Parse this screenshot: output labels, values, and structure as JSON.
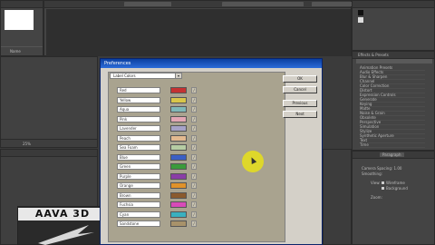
{
  "colors": {
    "workspace_bg": "#3b3b3b",
    "panel_bg": "#444444",
    "dialog_bg": "#d4d0c8",
    "dialog_title": "#0b3fa0",
    "cursor_highlight": "#e8e01a"
  },
  "project_panel": {
    "name_column": "Name"
  },
  "timeline_panel": {
    "zoom_label": "25%"
  },
  "logo": {
    "text": "AAVA 3D"
  },
  "dialog": {
    "title": "Preferences",
    "category": "Label Colors",
    "labels": [
      {
        "name": "Red",
        "color": "#c43232"
      },
      {
        "name": "Yellow",
        "color": "#d8c64a"
      },
      {
        "name": "Aqua",
        "color": "#7fb8b8"
      },
      {
        "name": "Pink",
        "color": "#e3a6b4"
      },
      {
        "name": "Lavender",
        "color": "#a6a2c7"
      },
      {
        "name": "Peach",
        "color": "#e2b98f"
      },
      {
        "name": "Sea Foam",
        "color": "#b6cca3"
      },
      {
        "name": "Blue",
        "color": "#3b5fc4"
      },
      {
        "name": "Green",
        "color": "#3b9a3b"
      },
      {
        "name": "Purple",
        "color": "#8a3ea6"
      },
      {
        "name": "Orange",
        "color": "#e0922a"
      },
      {
        "name": "Brown",
        "color": "#8a5a2e"
      },
      {
        "name": "Fuchsia",
        "color": "#d84ab8"
      },
      {
        "name": "Cyan",
        "color": "#3ab0bf"
      },
      {
        "name": "Sandstone",
        "color": "#a8926a"
      }
    ],
    "buttons": {
      "ok": "OK",
      "cancel": "Cancel",
      "previous": "Previous",
      "next": "Next"
    }
  },
  "effects_panel": {
    "title": "Effects & Presets",
    "items": [
      "Animation Presets",
      "Audio Effects",
      "Blur & Sharpen",
      "Channel",
      "Color Correction",
      "Distort",
      "Expression Controls",
      "Generate",
      "Keying",
      "Matte",
      "Noise & Grain",
      "Obsolete",
      "Perspective",
      "Simulation",
      "Stylize",
      "Synthetic Aperture",
      "Text",
      "Time"
    ]
  },
  "paragraph_panel": {
    "tab_paragraph": "Paragraph",
    "label_spacing": "Camera Spacing: 1.00",
    "label_smoothing": "Smoothing:",
    "label_view": "View:",
    "opt_wireframe": "Wireframe",
    "opt_background": "Background",
    "label_zoom": "Zoom:"
  }
}
